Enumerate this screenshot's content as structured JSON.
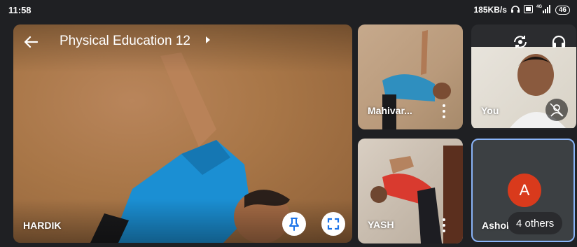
{
  "status_bar": {
    "time": "11:58",
    "network_speed": "185KB/s",
    "network_type": "4G",
    "battery": "46",
    "icons": [
      "headphones-icon",
      "volte-icon",
      "signal-icon",
      "battery-icon"
    ]
  },
  "meeting": {
    "title": "Physical Education 12"
  },
  "participants": {
    "main": {
      "name": "HARDIK"
    },
    "tile2": {
      "name": "Mahivar..."
    },
    "tile3": {
      "name": "YASH"
    },
    "self": {
      "name": "You"
    },
    "tile5": {
      "name": "Ashok",
      "avatar_letter": "A",
      "others_label": "4 others"
    }
  },
  "colors": {
    "background": "#1f2023",
    "avatar_red": "#d93a1c",
    "highlight_border": "#8ab4f8",
    "tile_gray": "#3c4043"
  }
}
